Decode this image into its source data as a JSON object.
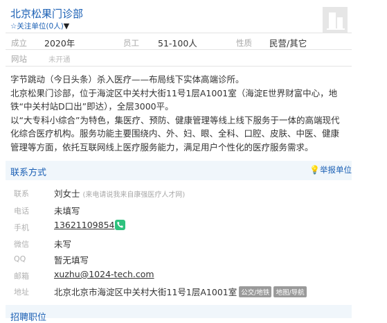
{
  "company": {
    "name": "北京松果门诊部",
    "follow_label": "关注单位(0人)",
    "follow_caret": "▼"
  },
  "info": {
    "founded_label": "成立",
    "founded_value": "2020年",
    "staff_label": "员工",
    "staff_value": "51-100人",
    "nature_label": "性质",
    "nature_value": "民营/其它",
    "website_label": "网站",
    "website_value": "未开通"
  },
  "description": [
    "字节跳动（今日头条）杀入医疗——布局线下实体高端诊所。",
    "北京松果门诊部，位于海淀区中关村大街11号1层A1001室（海淀E世界财富中心，地铁“中关村站D口出”即达），全层3000平。",
    "以“大专科小综合”为特色，集医疗、预防、健康管理等线上线下服务于一体的高端现代化综合医疗机构。服务功能主要围绕内、外、妇、眼、全科、口腔、皮肤、中医、健康管理等方面，依托互联网线上医疗服务能力，满足用户个性化的医疗服务需求。"
  ],
  "contact": {
    "section_title": "联系方式",
    "report_label": "举报单位",
    "contact_person_label": "联系",
    "contact_person": "刘女士",
    "contact_hint": "(来电请说我来自康强医疗人才网)",
    "tel_label": "电话",
    "tel_value": "未填写",
    "mobile_label": "手机",
    "mobile_value": "13621109854",
    "wechat_label": "微信",
    "wechat_value": "未写",
    "qq_label": "QQ",
    "qq_value": "暂无填写",
    "email_label": "邮箱",
    "email_value": "xuzhu@1024-tech.com",
    "address_label": "地址",
    "address_value": "北京北京市海淀区中关村大街11号1层A1001室",
    "transit_tag": "公交/地铁",
    "map_tag": "地图/导航"
  },
  "recruit": {
    "section_title": "招聘职位"
  },
  "icons": {
    "follow": "star-outline-icon",
    "report": "lightbulb-icon",
    "mobile": "phone-icon",
    "logo": "building-icon"
  },
  "colors": {
    "link_blue": "#1a5fb4",
    "section_bg": "#f0f6fb",
    "phone_green": "#2ec27e"
  }
}
